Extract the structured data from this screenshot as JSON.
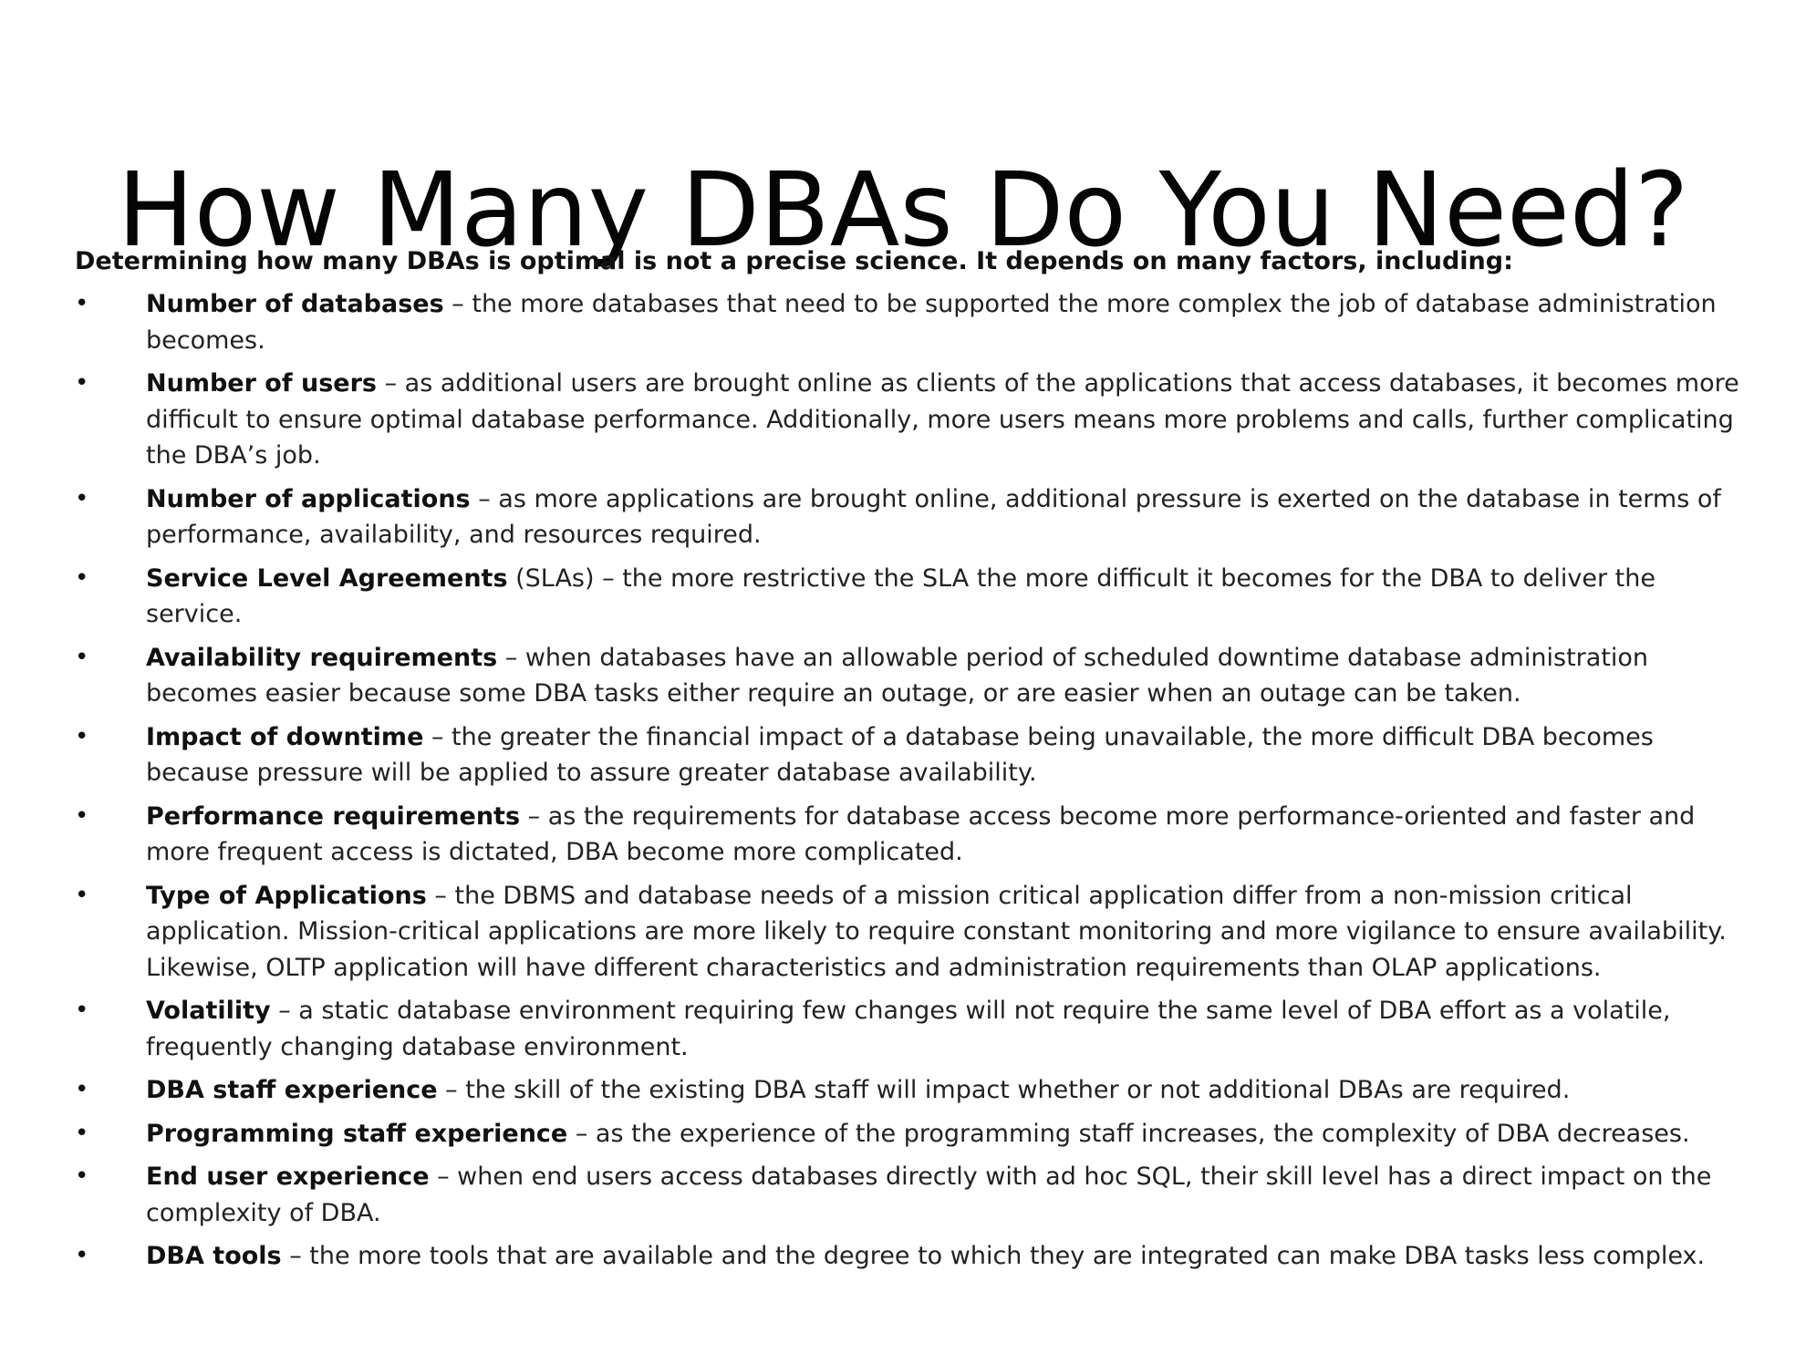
{
  "title": "How Many DBAs Do You Need?",
  "intro": "Determining how many DBAs is optimal is not a precise science. It depends on many factors, including:",
  "bullet_glyph": "•",
  "items": [
    {
      "term": "Number of databases",
      "desc": " – the more databases that need to be supported the more complex the job of database administration becomes."
    },
    {
      "term": "Number of users",
      "desc": " – as additional users are brought online as clients of the applications that access databases, it becomes more difficult to ensure optimal database performance. Additionally, more users means more problems and calls, further complicating the DBA’s job."
    },
    {
      "term": "Number of applications",
      "desc": " – as more applications are brought online, additional pressure is exerted on the database in terms of performance, availability, and resources required."
    },
    {
      "term": "Service Level Agreements",
      "desc": " (SLAs) – the more restrictive the SLA the more difficult it becomes for the DBA to deliver the service."
    },
    {
      "term": "Availability requirements",
      "desc": " – when databases have an allowable period of scheduled downtime database administration becomes easier because some DBA tasks either require an outage, or are easier when an outage can be taken."
    },
    {
      "term": "Impact of downtime",
      "desc": " – the greater the financial impact of a database being unavailable, the more difficult DBA becomes because pressure will be applied to assure greater database availability."
    },
    {
      "term": "Performance requirements",
      "desc": " – as the requirements for database access become more performance-oriented and faster and more frequent access is dictated, DBA become more complicated."
    },
    {
      "term": "Type of Applications",
      "desc": " – the DBMS and database needs of a mission critical application differ from a non-mission critical application. Mission-critical applications are more likely to require constant monitoring and more vigilance to ensure availability. Likewise, OLTP application will have different characteristics and administration requirements than OLAP applications."
    },
    {
      "term": "Volatility",
      "desc": " – a static database environment requiring few changes will not require the same level of DBA effort as a volatile, frequently changing database environment."
    },
    {
      "term": "DBA staff experience",
      "desc": " – the skill of the existing DBA staff will impact whether or not additional DBAs are required."
    },
    {
      "term": "Programming staff experience",
      "desc": " –  as the experience of the programming staff increases, the complexity of DBA decreases."
    },
    {
      "term": "End user experience",
      "desc": " – when end users access databases directly with ad hoc SQL, their skill level has a direct impact on the complexity of DBA."
    },
    {
      "term": "DBA tools",
      "desc": " – the more tools that are available and the degree to which they are integrated can make DBA tasks less complex."
    }
  ]
}
